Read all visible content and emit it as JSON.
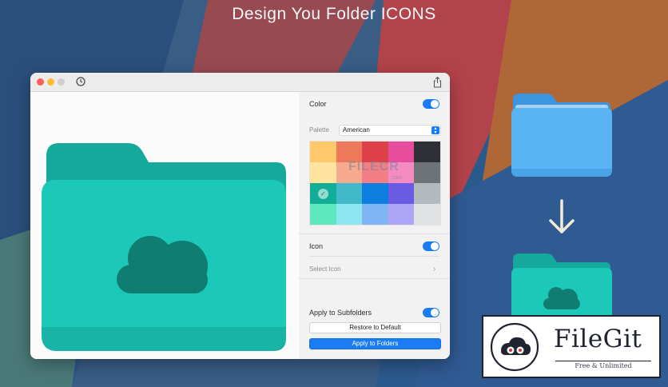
{
  "headline": "Design You Folder ICONS",
  "window": {
    "controls": {
      "close": "red",
      "minimize": "yellow",
      "zoom": "gray"
    },
    "toolbar_icons": [
      "clock-icon",
      "share-icon"
    ]
  },
  "preview": {
    "folder_color": "#1cc8b8",
    "folder_back_color": "#15a295",
    "glyph_color": "#0e7d72",
    "glyph": "cloud-icon"
  },
  "sidebar": {
    "color_label": "Color",
    "color_enabled": true,
    "palette_label": "Palette",
    "palette_value": "American",
    "swatches": [
      [
        "#ffc96b",
        "#ec7a5a",
        "#dd4048",
        "#e84c9d",
        "#2d3035"
      ],
      [
        "#ffe39e",
        "#f8aa8f",
        "#f37e86",
        "#f48cc3",
        "#6e7378"
      ],
      [
        "#11ad96",
        "#41b9c8",
        "#0d7de0",
        "#6b5be3",
        "#b4b9bf"
      ],
      [
        "#5ee8bd",
        "#8de6f0",
        "#7fb5f4",
        "#ada6f6",
        "#e0e3e6"
      ]
    ],
    "selected_swatch": "#11ad96",
    "icon_label": "Icon",
    "icon_enabled": true,
    "select_icon_label": "Select Icon",
    "apply_subfolders_label": "Apply to Subfolders",
    "apply_subfolders_enabled": true,
    "restore_button": "Restore to Default",
    "apply_button": "Apply to Folders"
  },
  "watermark": {
    "text": "FILECR",
    "sub": ".com"
  },
  "demo": {
    "before_folder_color": "#5ab3f3",
    "after_folder_color": "#1cc8b8",
    "arrow": "arrow-down-icon"
  },
  "badge": {
    "name": "FileGit",
    "tagline": "Free & Unlimited"
  },
  "colors": {
    "accent": "#1a7cf5"
  }
}
